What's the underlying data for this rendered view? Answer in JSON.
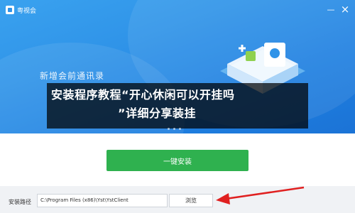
{
  "window": {
    "app_name": "粤视会",
    "minimize_glyph": "—",
    "close_glyph": "×"
  },
  "banner": {
    "headline": "新增会前通讯录",
    "page_dots": 3
  },
  "overlay": {
    "line1": "安装程序教程“开心休闲可以开挂吗",
    "line2": "”详细分享装挂"
  },
  "install": {
    "button_label": "一键安装"
  },
  "path": {
    "label": "安装路径",
    "value": "C:\\Program Files (x86)\\Yst\\YstClient",
    "browse_label": "浏览"
  },
  "colors": {
    "banner_blue": "#2f93e8",
    "install_green": "#2fb14f",
    "arrow_red": "#e02020"
  },
  "icons": [
    "app-logo-icon",
    "minimize-icon",
    "close-icon",
    "red-arrow-icon"
  ]
}
